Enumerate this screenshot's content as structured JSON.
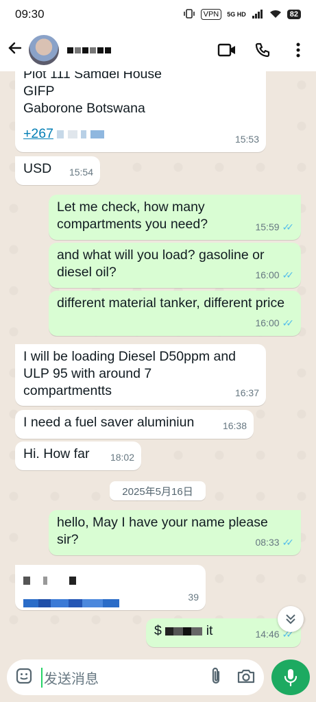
{
  "status_bar": {
    "time": "09:30",
    "vpn": "VPN",
    "network": "5G HD",
    "battery": "82"
  },
  "header": {
    "back_icon": "arrow-left-icon",
    "video_icon": "video-call-icon",
    "call_icon": "phone-icon",
    "menu_icon": "more-vertical-icon"
  },
  "messages": [
    {
      "dir": "in",
      "lines": [
        "Plot 111 Samdel House",
        "GIFP",
        "Gaborone Botswana"
      ],
      "link": "+267",
      "time": "15:53"
    },
    {
      "dir": "in",
      "text": "USD",
      "time": "15:54"
    },
    {
      "dir": "out",
      "text": "Let me check, how many compartments you need?",
      "time": "15:59"
    },
    {
      "dir": "out",
      "text": "and what will you load? gasoline or diesel oil?",
      "time": "16:00"
    },
    {
      "dir": "out",
      "text": "different material tanker, different price",
      "time": "16:00"
    },
    {
      "dir": "in",
      "text": "I will be loading Diesel D50ppm and ULP 95 with around 7 compartmentts",
      "time": "16:37"
    },
    {
      "dir": "in",
      "text": "I need a fuel saver aluminiun",
      "time": "16:38"
    },
    {
      "dir": "in",
      "text": "Hi. How far",
      "time": "18:02"
    },
    {
      "dir": "out",
      "text": "hello, May I have your name please sir?",
      "time": "08:33"
    },
    {
      "dir": "in",
      "text": "",
      "time": "39"
    },
    {
      "dir": "out",
      "text_prefix": "$",
      "text_suffix": "it",
      "time": "14:46"
    }
  ],
  "date_chip": "2025年5月16日",
  "input": {
    "placeholder": "发送消息"
  },
  "colors": {
    "incoming": "#ffffff",
    "outgoing": "#d9fdd3",
    "read_ticks": "#53bdeb",
    "mic": "#1daa61",
    "link": "#027eb5"
  }
}
